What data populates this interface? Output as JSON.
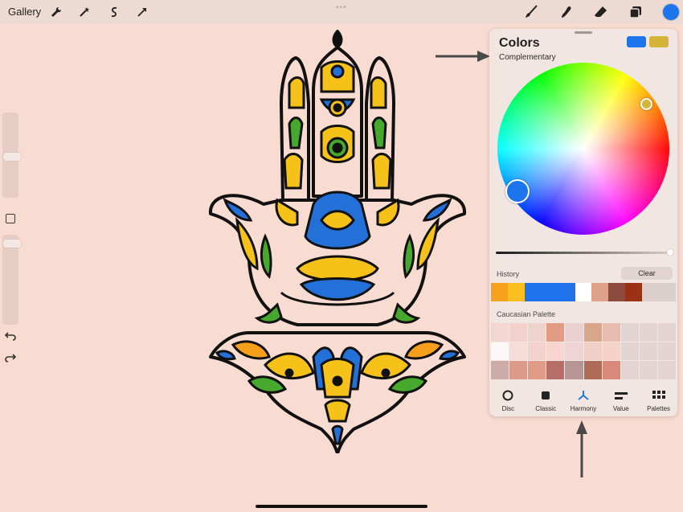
{
  "topbar": {
    "gallery_label": "Gallery",
    "tools_left": [
      {
        "name": "wrench-icon"
      },
      {
        "name": "magic-wand-icon"
      },
      {
        "name": "selection-icon"
      },
      {
        "name": "transform-arrow-icon"
      }
    ],
    "tools_right": [
      {
        "name": "brush-icon"
      },
      {
        "name": "smudge-icon"
      },
      {
        "name": "eraser-icon"
      },
      {
        "name": "layers-icon"
      }
    ],
    "current_color": "#1d75ee"
  },
  "sidebar": {
    "icons": [
      "undo-icon",
      "redo-icon"
    ]
  },
  "colors_panel": {
    "title": "Colors",
    "mode": "Complementary",
    "primary_color": "#1d75ee",
    "secondary_color": "#d6b339",
    "history_label": "History",
    "clear_label": "Clear",
    "history": [
      "#f7a21c",
      "#fbbf1f",
      "#1f74ee",
      "#1f74ee",
      "#1f74ee",
      "#ffffff",
      "#e0a18b",
      "#8c4b3d",
      "#9b3216",
      "#dcd0ce",
      "#dcd0ce"
    ],
    "palette_label": "Caucasian Palette",
    "palette": [
      "#f4d6d1",
      "#f2d0cb",
      "#f0d2cc",
      "#e39b84",
      "#ead0d1",
      "#d9a68a",
      "#e8bcae",
      "#e2d4d3",
      "#e2d4d3",
      "#e2d4d3",
      "#fcf8f7",
      "#f6ddd8",
      "#f3d1cc",
      "#f8d6d0",
      "#f0d3d6",
      "#f0cfc7",
      "#f5d2c8",
      "#e2d4d3",
      "#e2d4d3",
      "#e2d4d3",
      "#ccaba8",
      "#dc9a8b",
      "#e19c88",
      "#b66e67",
      "#b79597",
      "#b06a58",
      "#d9897a",
      "#e2d4d3",
      "#e2d4d3",
      "#e2d4d3"
    ],
    "tabs": [
      {
        "label": "Disc",
        "icon": "disc-icon",
        "active": false
      },
      {
        "label": "Classic",
        "icon": "classic-square-icon",
        "active": false
      },
      {
        "label": "Harmony",
        "icon": "harmony-icon",
        "active": true
      },
      {
        "label": "Value",
        "icon": "value-sliders-icon",
        "active": false
      },
      {
        "label": "Palettes",
        "icon": "palettes-grid-icon",
        "active": false
      }
    ],
    "accent": "#1f7be8"
  }
}
